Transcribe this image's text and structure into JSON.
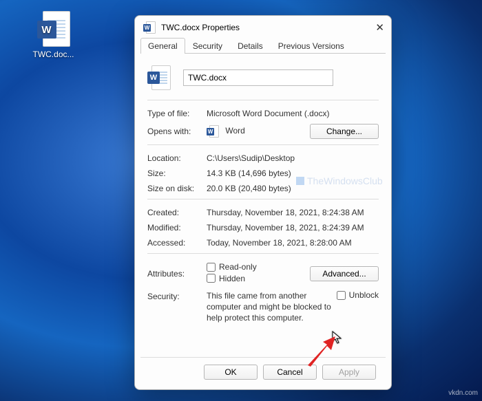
{
  "desktop": {
    "file_label": "TWC.doc..."
  },
  "dialog": {
    "title": "TWC.docx Properties",
    "tabs": [
      "General",
      "Security",
      "Details",
      "Previous Versions"
    ],
    "filename": "TWC.docx",
    "type_label": "Type of file:",
    "type_value": "Microsoft Word Document (.docx)",
    "opens_label": "Opens with:",
    "opens_value": "Word",
    "change_btn": "Change...",
    "location_label": "Location:",
    "location_value": "C:\\Users\\Sudip\\Desktop",
    "size_label": "Size:",
    "size_value": "14.3 KB (14,696 bytes)",
    "disk_label": "Size on disk:",
    "disk_value": "20.0 KB (20,480 bytes)",
    "created_label": "Created:",
    "created_value": "Thursday, November 18, 2021, 8:24:38 AM",
    "modified_label": "Modified:",
    "modified_value": "Thursday, November 18, 2021, 8:24:39 AM",
    "accessed_label": "Accessed:",
    "accessed_value": "Today, November 18, 2021, 8:28:00 AM",
    "attr_label": "Attributes:",
    "readonly_label": "Read-only",
    "hidden_label": "Hidden",
    "advanced_btn": "Advanced...",
    "security_label": "Security:",
    "security_text": "This file came from another computer and might be blocked to help protect this computer.",
    "unblock_label": "Unblock",
    "ok_btn": "OK",
    "cancel_btn": "Cancel",
    "apply_btn": "Apply"
  },
  "watermark": "TheWindowsClub",
  "credit": "vkdn.com"
}
